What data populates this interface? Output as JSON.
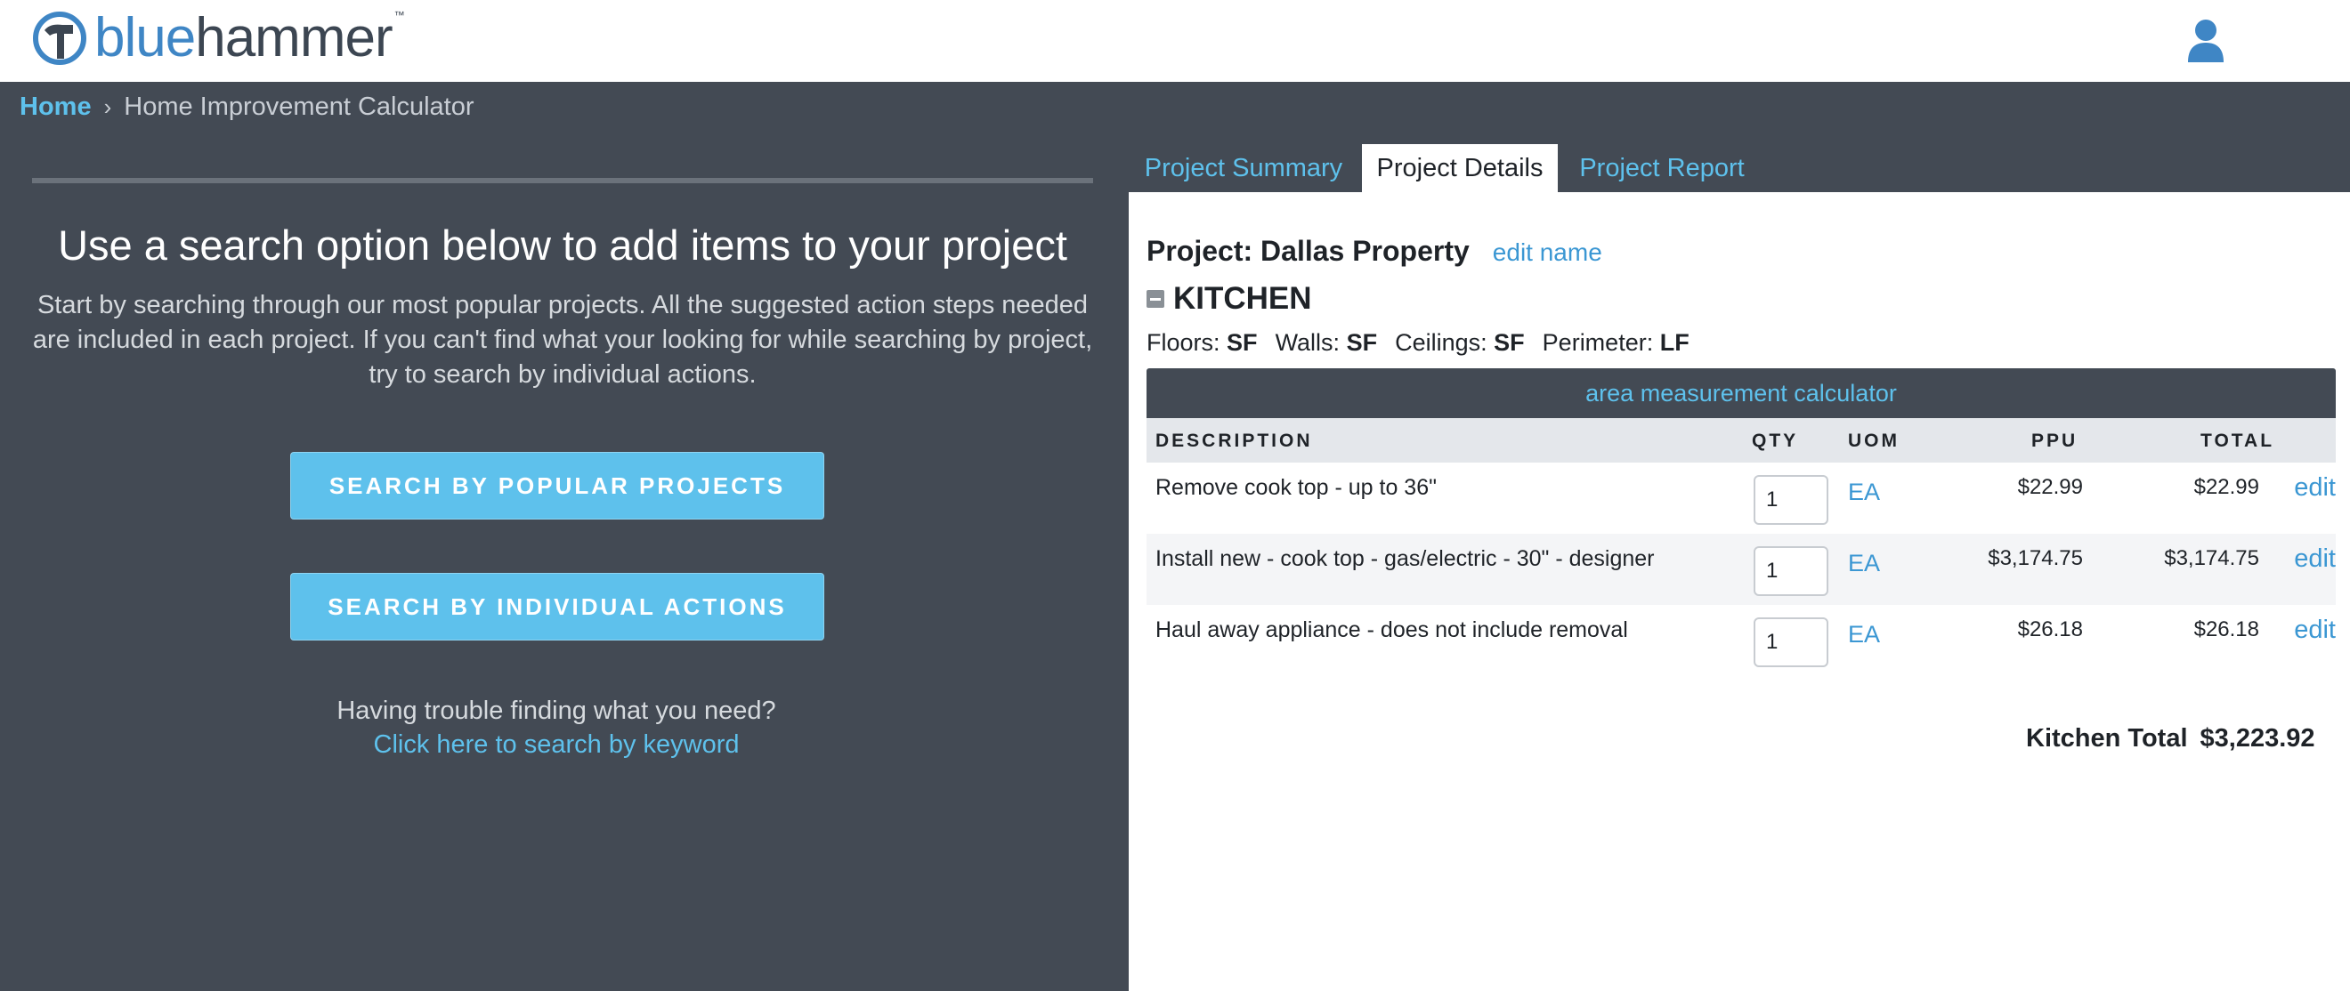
{
  "header": {
    "logo": {
      "part1": "blue",
      "part2": "hammer",
      "tm": "™"
    },
    "colors": {
      "brand_blue": "#3f86c5",
      "brand_dark": "#3c4652"
    }
  },
  "breadcrumb": {
    "home": "Home",
    "current": "Home Improvement Calculator"
  },
  "left": {
    "title": "Use a search option below to add items to your project",
    "description": "Start by searching through our most popular projects. All the suggested action steps needed are included in each project. If you can't find what your looking for while searching by project, try to search by individual actions.",
    "button_popular": "SEARCH BY POPULAR PROJECTS",
    "button_actions": "SEARCH BY INDIVIDUAL ACTIONS",
    "trouble_text": "Having trouble finding what you need?",
    "keyword_link": "Click here to search by keyword"
  },
  "tabs": [
    {
      "label": "Project Summary",
      "active": false
    },
    {
      "label": "Project Details",
      "active": true
    },
    {
      "label": "Project Report",
      "active": false
    }
  ],
  "project": {
    "name_label": "Project: Dallas Property",
    "edit_name": "edit name",
    "room": "KITCHEN",
    "measures": {
      "floors_label": "Floors:",
      "floors_unit": "SF",
      "walls_label": "Walls:",
      "walls_unit": "SF",
      "ceilings_label": "Ceilings:",
      "ceilings_unit": "SF",
      "perimeter_label": "Perimeter:",
      "perimeter_unit": "LF"
    },
    "calculator_link": "area measurement calculator",
    "columns": {
      "description": "DESCRIPTION",
      "qty": "QTY",
      "uom": "UOM",
      "ppu": "PPU",
      "total": "TOTAL"
    },
    "items": [
      {
        "description": "Remove cook top - up to 36\"",
        "qty": "1",
        "uom": "EA",
        "ppu": "$22.99",
        "total": "$22.99",
        "edit": "edit"
      },
      {
        "description": "Install new - cook top - gas/electric - 30\" - designer",
        "qty": "1",
        "uom": "EA",
        "ppu": "$3,174.75",
        "total": "$3,174.75",
        "edit": "edit"
      },
      {
        "description": "Haul away appliance - does not include removal",
        "qty": "1",
        "uom": "EA",
        "ppu": "$26.18",
        "total": "$26.18",
        "edit": "edit"
      }
    ],
    "total_label": "Kitchen Total",
    "total_value": "$3,223.92"
  }
}
